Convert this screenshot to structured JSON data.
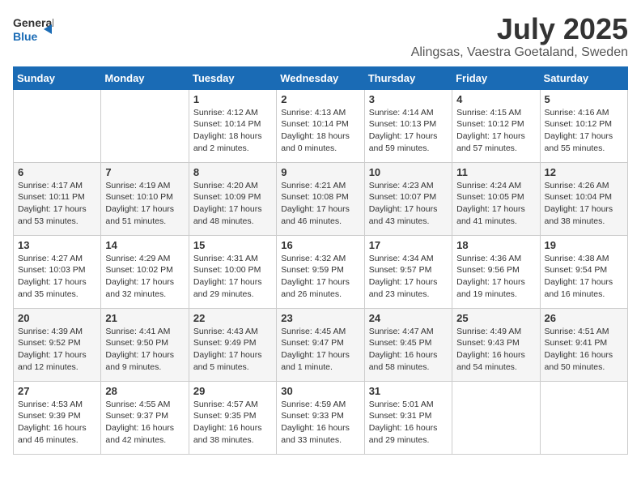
{
  "header": {
    "logo_general": "General",
    "logo_blue": "Blue",
    "month": "July 2025",
    "location": "Alingsas, Vaestra Goetaland, Sweden"
  },
  "days_of_week": [
    "Sunday",
    "Monday",
    "Tuesday",
    "Wednesday",
    "Thursday",
    "Friday",
    "Saturday"
  ],
  "weeks": [
    [
      {
        "day": "",
        "info": ""
      },
      {
        "day": "",
        "info": ""
      },
      {
        "day": "1",
        "info": "Sunrise: 4:12 AM\nSunset: 10:14 PM\nDaylight: 18 hours\nand 2 minutes."
      },
      {
        "day": "2",
        "info": "Sunrise: 4:13 AM\nSunset: 10:14 PM\nDaylight: 18 hours\nand 0 minutes."
      },
      {
        "day": "3",
        "info": "Sunrise: 4:14 AM\nSunset: 10:13 PM\nDaylight: 17 hours\nand 59 minutes."
      },
      {
        "day": "4",
        "info": "Sunrise: 4:15 AM\nSunset: 10:12 PM\nDaylight: 17 hours\nand 57 minutes."
      },
      {
        "day": "5",
        "info": "Sunrise: 4:16 AM\nSunset: 10:12 PM\nDaylight: 17 hours\nand 55 minutes."
      }
    ],
    [
      {
        "day": "6",
        "info": "Sunrise: 4:17 AM\nSunset: 10:11 PM\nDaylight: 17 hours\nand 53 minutes."
      },
      {
        "day": "7",
        "info": "Sunrise: 4:19 AM\nSunset: 10:10 PM\nDaylight: 17 hours\nand 51 minutes."
      },
      {
        "day": "8",
        "info": "Sunrise: 4:20 AM\nSunset: 10:09 PM\nDaylight: 17 hours\nand 48 minutes."
      },
      {
        "day": "9",
        "info": "Sunrise: 4:21 AM\nSunset: 10:08 PM\nDaylight: 17 hours\nand 46 minutes."
      },
      {
        "day": "10",
        "info": "Sunrise: 4:23 AM\nSunset: 10:07 PM\nDaylight: 17 hours\nand 43 minutes."
      },
      {
        "day": "11",
        "info": "Sunrise: 4:24 AM\nSunset: 10:05 PM\nDaylight: 17 hours\nand 41 minutes."
      },
      {
        "day": "12",
        "info": "Sunrise: 4:26 AM\nSunset: 10:04 PM\nDaylight: 17 hours\nand 38 minutes."
      }
    ],
    [
      {
        "day": "13",
        "info": "Sunrise: 4:27 AM\nSunset: 10:03 PM\nDaylight: 17 hours\nand 35 minutes."
      },
      {
        "day": "14",
        "info": "Sunrise: 4:29 AM\nSunset: 10:02 PM\nDaylight: 17 hours\nand 32 minutes."
      },
      {
        "day": "15",
        "info": "Sunrise: 4:31 AM\nSunset: 10:00 PM\nDaylight: 17 hours\nand 29 minutes."
      },
      {
        "day": "16",
        "info": "Sunrise: 4:32 AM\nSunset: 9:59 PM\nDaylight: 17 hours\nand 26 minutes."
      },
      {
        "day": "17",
        "info": "Sunrise: 4:34 AM\nSunset: 9:57 PM\nDaylight: 17 hours\nand 23 minutes."
      },
      {
        "day": "18",
        "info": "Sunrise: 4:36 AM\nSunset: 9:56 PM\nDaylight: 17 hours\nand 19 minutes."
      },
      {
        "day": "19",
        "info": "Sunrise: 4:38 AM\nSunset: 9:54 PM\nDaylight: 17 hours\nand 16 minutes."
      }
    ],
    [
      {
        "day": "20",
        "info": "Sunrise: 4:39 AM\nSunset: 9:52 PM\nDaylight: 17 hours\nand 12 minutes."
      },
      {
        "day": "21",
        "info": "Sunrise: 4:41 AM\nSunset: 9:50 PM\nDaylight: 17 hours\nand 9 minutes."
      },
      {
        "day": "22",
        "info": "Sunrise: 4:43 AM\nSunset: 9:49 PM\nDaylight: 17 hours\nand 5 minutes."
      },
      {
        "day": "23",
        "info": "Sunrise: 4:45 AM\nSunset: 9:47 PM\nDaylight: 17 hours\nand 1 minute."
      },
      {
        "day": "24",
        "info": "Sunrise: 4:47 AM\nSunset: 9:45 PM\nDaylight: 16 hours\nand 58 minutes."
      },
      {
        "day": "25",
        "info": "Sunrise: 4:49 AM\nSunset: 9:43 PM\nDaylight: 16 hours\nand 54 minutes."
      },
      {
        "day": "26",
        "info": "Sunrise: 4:51 AM\nSunset: 9:41 PM\nDaylight: 16 hours\nand 50 minutes."
      }
    ],
    [
      {
        "day": "27",
        "info": "Sunrise: 4:53 AM\nSunset: 9:39 PM\nDaylight: 16 hours\nand 46 minutes."
      },
      {
        "day": "28",
        "info": "Sunrise: 4:55 AM\nSunset: 9:37 PM\nDaylight: 16 hours\nand 42 minutes."
      },
      {
        "day": "29",
        "info": "Sunrise: 4:57 AM\nSunset: 9:35 PM\nDaylight: 16 hours\nand 38 minutes."
      },
      {
        "day": "30",
        "info": "Sunrise: 4:59 AM\nSunset: 9:33 PM\nDaylight: 16 hours\nand 33 minutes."
      },
      {
        "day": "31",
        "info": "Sunrise: 5:01 AM\nSunset: 9:31 PM\nDaylight: 16 hours\nand 29 minutes."
      },
      {
        "day": "",
        "info": ""
      },
      {
        "day": "",
        "info": ""
      }
    ]
  ]
}
